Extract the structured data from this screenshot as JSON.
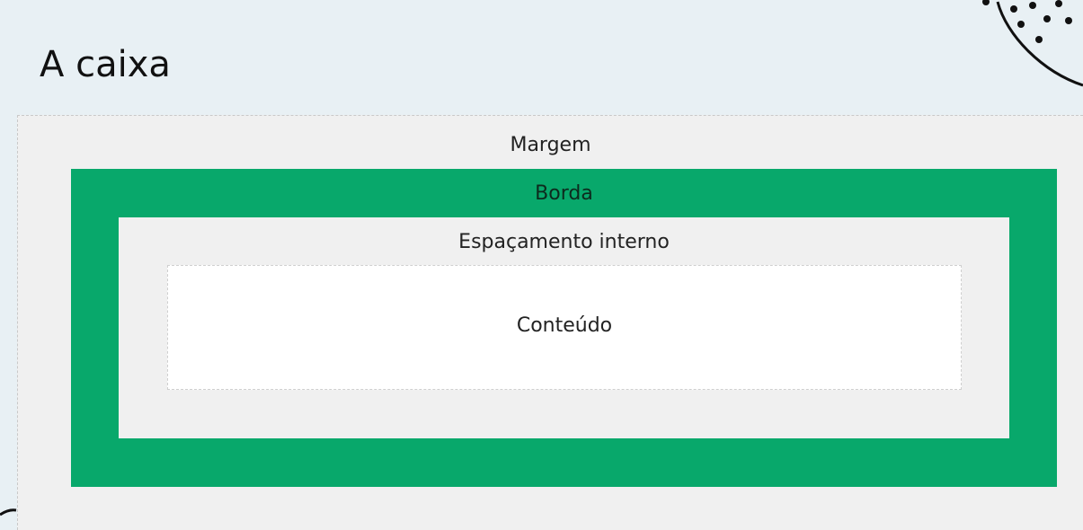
{
  "title": "A caixa",
  "diagram": {
    "margin_label": "Margem",
    "border_label": "Borda",
    "padding_label": "Espaçamento interno",
    "content_label": "Conteúdo"
  },
  "colors": {
    "background": "#e8f0f4",
    "margin": "#f0f0f0",
    "border": "#08a86b",
    "padding": "#f0f0f0",
    "content": "#ffffff"
  }
}
